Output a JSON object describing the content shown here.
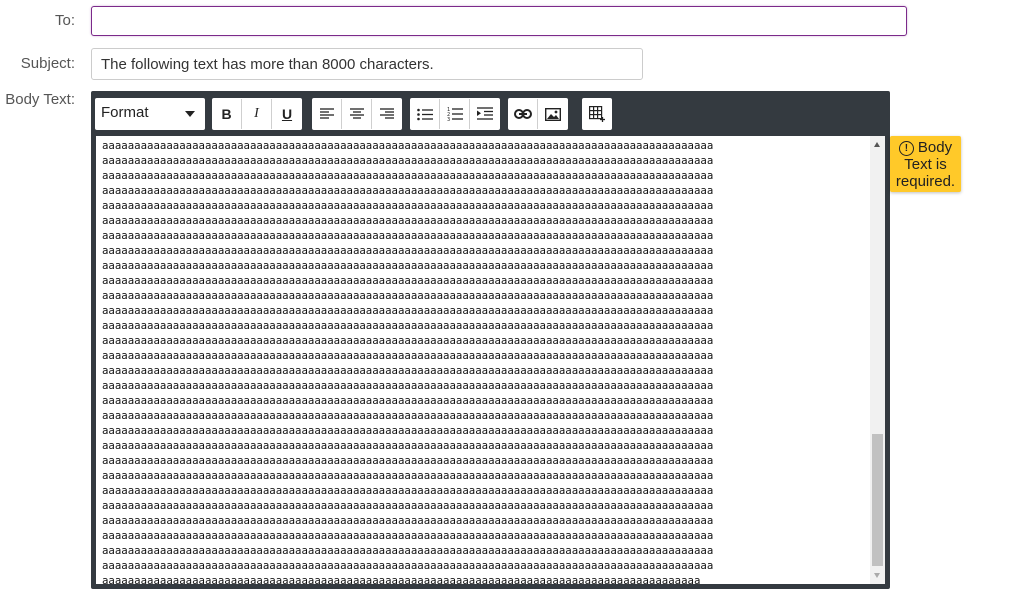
{
  "form": {
    "to_label": "To:",
    "to_value": "",
    "subject_label": "Subject:",
    "subject_value": "The following text has more than 8000 characters.",
    "body_label": "Body Text:"
  },
  "toolbar": {
    "format_label": "Format",
    "format_caret_icon": "chevron-down-icon",
    "groups": [
      [
        "bold-icon",
        "italic-icon",
        "underline-icon"
      ],
      [
        "align-left-icon",
        "align-center-icon",
        "align-right-icon"
      ],
      [
        "bullet-list-icon",
        "numbered-list-icon",
        "indent-icon"
      ],
      [
        "link-icon",
        "image-icon"
      ],
      [
        "table-icon"
      ]
    ],
    "bold_glyph": "B",
    "italic_glyph": "I",
    "underline_glyph": "U"
  },
  "body": {
    "line": "aaaaaaaaaaaaaaaaaaaaaaaaaaaaaaaaaaaaaaaaaaaaaaaaaaaaaaaaaaaaaaaaaaaaaaaaaaaaaaaaaaaaaaaaaaaaaaa",
    "last_line": "aaaaaaaaaaaaaaaaaaaaaaaaaaaaaaaaaaaaaaaaaaaaaaaaaaaaaaaaaaaaaaaaaaaaaaaaaaaaaaaaaaaaaaaaaaaaa"
  },
  "validation": {
    "icon": "exclamation-circle-icon",
    "icon_glyph": "!",
    "message_line1": "Body",
    "message_line2": "Text is",
    "message_line3": "required."
  },
  "colors": {
    "toolbar_bg": "#343a40",
    "focus_border": "#7b2a8a",
    "tooltip_bg": "#ffc929"
  }
}
